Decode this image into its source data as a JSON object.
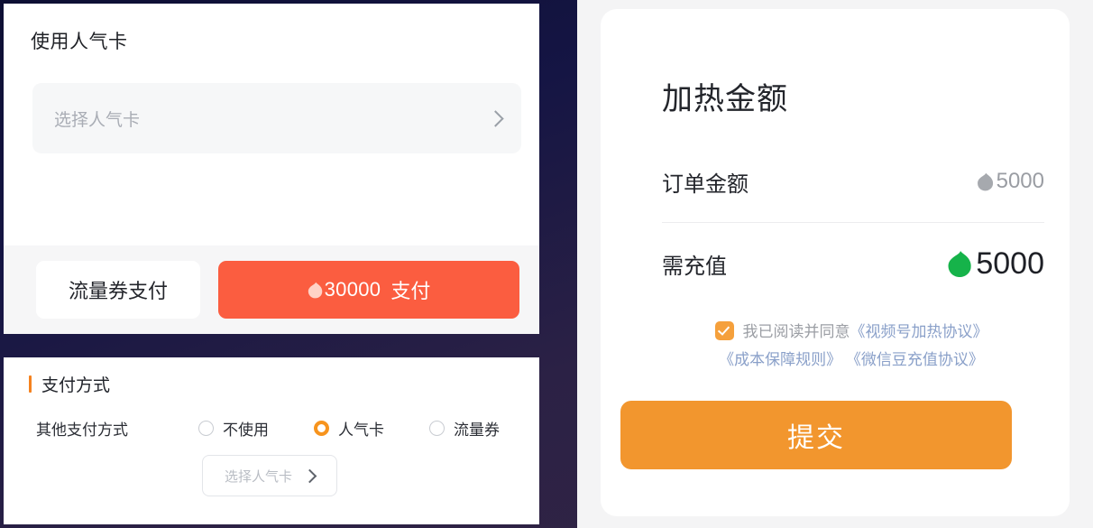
{
  "theme": {
    "accent_orange": "#f2962e",
    "accent_red": "#fb5d40",
    "radio_orange": "#f7941e",
    "bean_green": "#16b34a",
    "bean_gray": "#a6a9ae",
    "link_blue": "#8aa0c9",
    "background": "#151544"
  },
  "left": {
    "popularity_card": {
      "section_label": "使用人气卡",
      "select_placeholder": "选择人气卡",
      "chevron_icon": "chevron-right-icon"
    },
    "pay_bar": {
      "coupon_button": "流量券支付",
      "pay_button_amount": "30000",
      "pay_button_suffix": "支付",
      "pay_bean_icon": "bean-icon"
    },
    "payment_method": {
      "title": "支付方式",
      "row_label": "其他支付方式",
      "options": [
        {
          "label": "不使用",
          "selected": false
        },
        {
          "label": "人气卡",
          "selected": true
        },
        {
          "label": "流量券",
          "selected": false
        }
      ],
      "card_select_placeholder": "选择人气卡",
      "chevron_icon": "chevron-right-icon"
    }
  },
  "right": {
    "title": "加热金额",
    "rows": [
      {
        "label": "订单金额",
        "value": "5000",
        "icon": "bean-icon-gray"
      },
      {
        "label": "需充值",
        "value": "5000",
        "icon": "bean-icon-green"
      }
    ],
    "agreement": {
      "checked": true,
      "checkbox_icon": "checkbox-checked-icon",
      "prefix": "我已阅读并同意",
      "links": [
        "《视频号加热协议》",
        "《成本保障规则》",
        "《微信豆充值协议》"
      ]
    },
    "submit_label": "提交"
  }
}
